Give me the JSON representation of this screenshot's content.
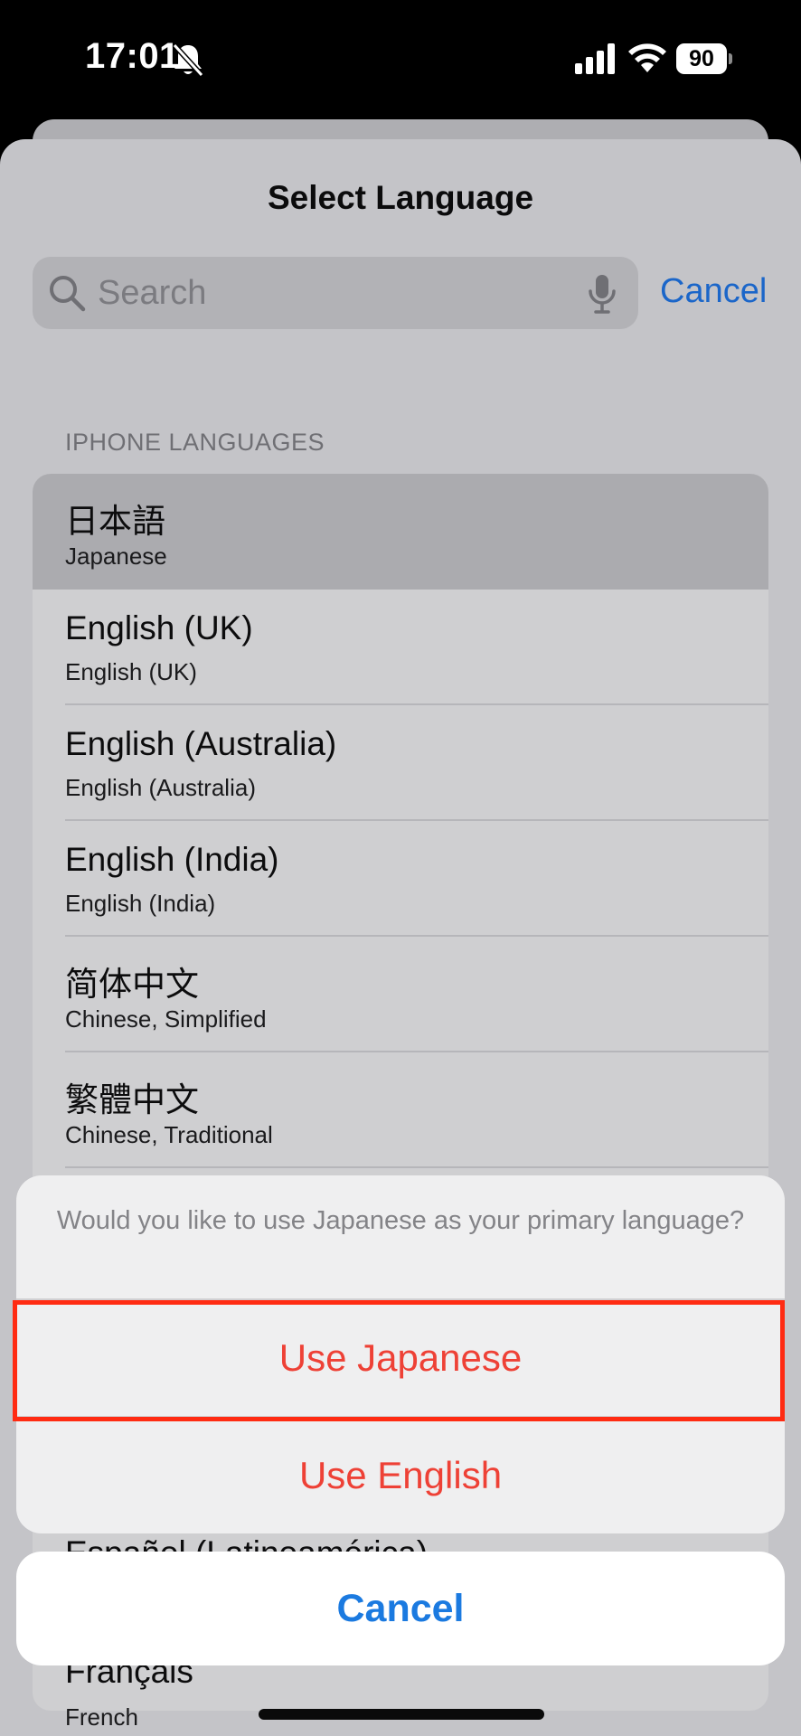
{
  "status_bar": {
    "time": "17:01",
    "battery": "90"
  },
  "sheet": {
    "title": "Select Language",
    "search_placeholder": "Search",
    "cancel_label": "Cancel",
    "section_header": "IPHONE LANGUAGES"
  },
  "languages": [
    {
      "name": "日本語",
      "subtitle": "Japanese"
    },
    {
      "name": "English (UK)",
      "subtitle": "English (UK)"
    },
    {
      "name": "English (Australia)",
      "subtitle": "English (Australia)"
    },
    {
      "name": "English (India)",
      "subtitle": "English (India)"
    },
    {
      "name": "简体中文",
      "subtitle": "Chinese, Simplified"
    },
    {
      "name": "繁體中文",
      "subtitle": "Chinese, Traditional"
    }
  ],
  "behind": {
    "partial_name": "Español (Latinoamérica)",
    "french_name": "Français",
    "french_sub": "French"
  },
  "action_sheet": {
    "message": "Would you like to use Japanese as your primary language?",
    "use_japanese": "Use Japanese",
    "use_english": "Use English",
    "cancel": "Cancel"
  }
}
